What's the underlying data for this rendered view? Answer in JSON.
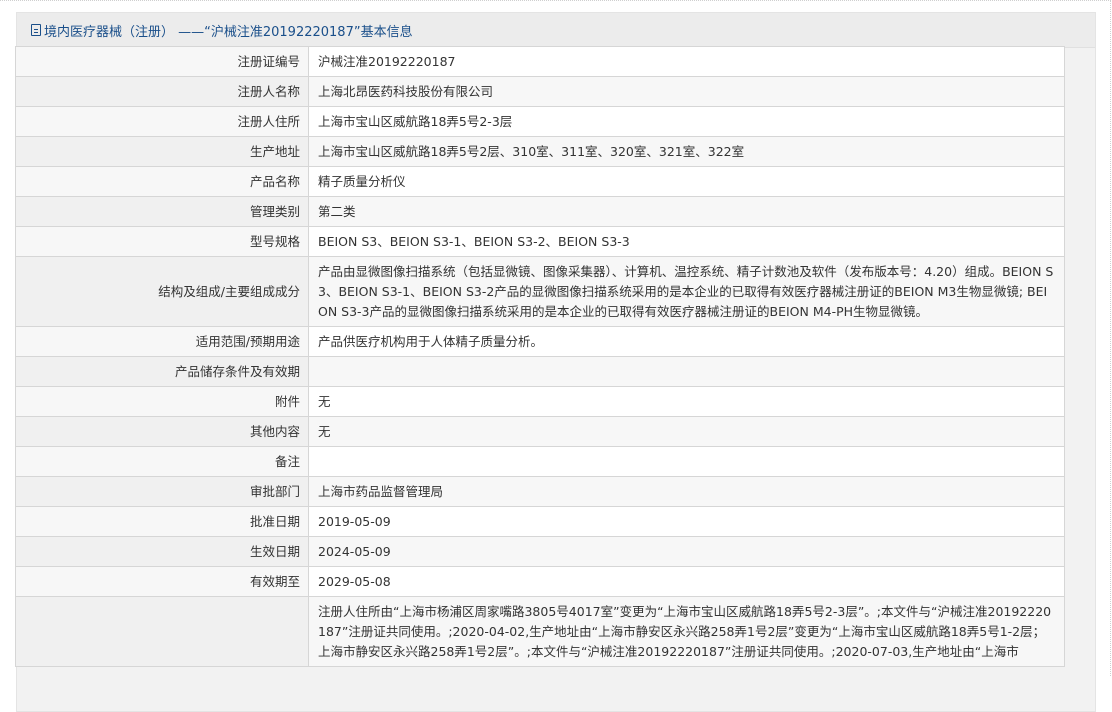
{
  "header": {
    "title": "境内医疗器械（注册） ——“沪械注准20192220187”基本信息"
  },
  "rows": [
    {
      "label": "注册证编号",
      "value": "沪械注准20192220187"
    },
    {
      "label": "注册人名称",
      "value": "上海北昂医药科技股份有限公司"
    },
    {
      "label": "注册人住所",
      "value": "上海市宝山区威航路18弄5号2-3层"
    },
    {
      "label": "生产地址",
      "value": "上海市宝山区威航路18弄5号2层、310室、311室、320室、321室、322室"
    },
    {
      "label": "产品名称",
      "value": "精子质量分析仪"
    },
    {
      "label": "管理类别",
      "value": "第二类"
    },
    {
      "label": "型号规格",
      "value": "BEION S3、BEION S3-1、BEION S3-2、BEION S3-3"
    },
    {
      "label": "结构及组成/主要组成成分",
      "value": "产品由显微图像扫描系统（包括显微镜、图像采集器）、计算机、温控系统、精子计数池及软件（发布版本号：4.20）组成。BEION S3、BEION S3-1、BEION S3-2产品的显微图像扫描系统采用的是本企业的已取得有效医疗器械注册证的BEION M3生物显微镜; BEION S3-3产品的显微图像扫描系统采用的是本企业的已取得有效医疗器械注册证的BEION M4-PH生物显微镜。"
    },
    {
      "label": "适用范围/预期用途",
      "value": "产品供医疗机构用于人体精子质量分析。"
    },
    {
      "label": "产品储存条件及有效期",
      "value": ""
    },
    {
      "label": "附件",
      "value": "无"
    },
    {
      "label": "其他内容",
      "value": "无"
    },
    {
      "label": "备注",
      "value": ""
    },
    {
      "label": "审批部门",
      "value": "上海市药品监督管理局"
    },
    {
      "label": "批准日期",
      "value": "2019-05-09"
    },
    {
      "label": "生效日期",
      "value": "2024-05-09"
    },
    {
      "label": "有效期至",
      "value": "2029-05-08"
    },
    {
      "label": "",
      "value": "注册人住所由“上海市杨浦区周家嘴路3805号4017室”变更为“上海市宝山区威航路18弄5号2-3层”。;本文件与“沪械注准20192220187”注册证共同使用。;2020-04-02,生产地址由“上海市静安区永兴路258弄1号2层”变更为“上海市宝山区威航路18弄5号1-2层；上海市静安区永兴路258弄1号2层”。;本文件与“沪械注准20192220187”注册证共同使用。;2020-07-03,生产地址由“上海市"
    }
  ]
}
